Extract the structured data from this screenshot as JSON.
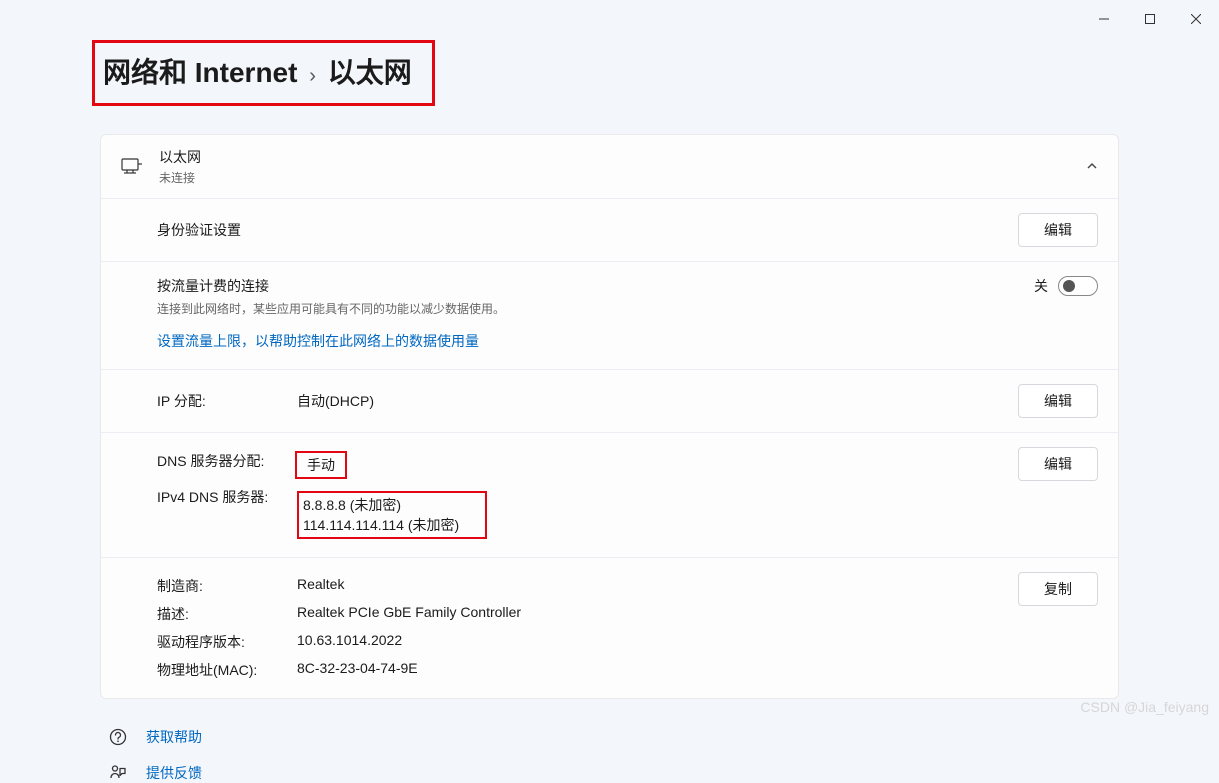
{
  "window_controls": {
    "min": "—",
    "max": "❐",
    "close": "✕"
  },
  "breadcrumb": {
    "parent": "网络和 Internet",
    "chev": "›",
    "current": "以太网"
  },
  "connection": {
    "title": "以太网",
    "status": "未连接"
  },
  "auth": {
    "label": "身份验证设置",
    "button": "编辑"
  },
  "metered": {
    "label": "按流量计费的连接",
    "desc": "连接到此网络时，某些应用可能具有不同的功能以减少数据使用。",
    "link": "设置流量上限，以帮助控制在此网络上的数据使用量",
    "toggle_label": "关"
  },
  "ip": {
    "label": "IP 分配:",
    "value": "自动(DHCP)",
    "button": "编辑"
  },
  "dns": {
    "assign_label": "DNS 服务器分配:",
    "assign_value": "手动",
    "ipv4_label": "IPv4 DNS 服务器:",
    "ipv4_value1": "8.8.8.8 (未加密)",
    "ipv4_value2": "114.114.114.114 (未加密)",
    "button": "编辑"
  },
  "hw": {
    "manufacturer_label": "制造商:",
    "manufacturer_value": "Realtek",
    "desc_label": "描述:",
    "desc_value": "Realtek PCIe GbE Family Controller",
    "driver_label": "驱动程序版本:",
    "driver_value": "10.63.1014.2022",
    "mac_label": "物理地址(MAC):",
    "mac_value": "8C-32-23-04-74-9E",
    "button": "复制"
  },
  "footer": {
    "help": "获取帮助",
    "feedback": "提供反馈"
  },
  "watermark": "CSDN @Jia_feiyang"
}
